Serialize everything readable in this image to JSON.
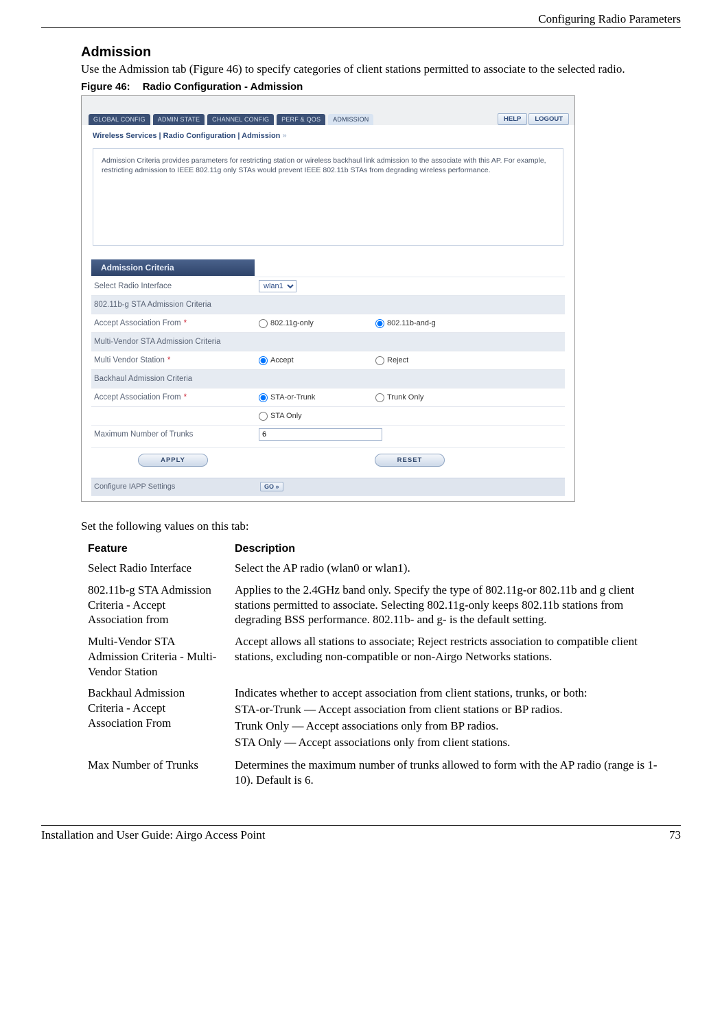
{
  "header": {
    "chapter": "Configuring Radio Parameters"
  },
  "section": {
    "title": "Admission",
    "intro": "Use the Admission tab (Figure 46) to specify categories of client stations permitted to associate to the selected radio.",
    "fig_num": "Figure 46:",
    "fig_title": "Radio Configuration - Admission",
    "after_fig": "Set the following values on this tab:"
  },
  "screenshot": {
    "tabs": [
      "GLOBAL CONFIG",
      "ADMIN STATE",
      "CHANNEL CONFIG",
      "PERF & QOS",
      "ADMISSION"
    ],
    "active_tab_index": 4,
    "top_buttons": {
      "help": "HELP",
      "logout": "LOGOUT"
    },
    "breadcrumb": "Wireless Services | Radio Configuration | Admission",
    "breadcrumb_arrows": "»",
    "desc_text": "Admission Criteria provides parameters for restricting station or wireless backhaul link admission to the associate with this AP. For example, restricting admission to IEEE 802.11g only STAs would prevent IEEE 802.11b STAs from degrading wireless performance.",
    "section_header": "Admission Criteria",
    "rows": {
      "select_radio_label": "Select Radio Interface",
      "select_radio_value": "wlan1",
      "sub1": "802.11b-g STA Admission Criteria",
      "accept_assoc_label": "Accept Association From",
      "accept_assoc_opt1": "802.11g-only",
      "accept_assoc_opt2": "802.11b-and-g",
      "sub2": "Multi-Vendor STA Admission Criteria",
      "multi_vendor_label": "Multi Vendor Station",
      "multi_vendor_opt1": "Accept",
      "multi_vendor_opt2": "Reject",
      "sub3": "Backhaul Admission Criteria",
      "backhaul_label": "Accept Association From",
      "backhaul_opt1": "STA-or-Trunk",
      "backhaul_opt2": "Trunk Only",
      "backhaul_opt3": "STA Only",
      "max_trunks_label": "Maximum Number of Trunks",
      "max_trunks_value": "6",
      "apply": "APPLY",
      "reset": "RESET",
      "iapp_label": "Configure IAPP Settings",
      "go": "GO »"
    }
  },
  "table": {
    "head_feature": "Feature",
    "head_desc": "Description",
    "rows": [
      {
        "feature": "Select Radio Interface",
        "desc": [
          "Select the AP radio (wlan0 or wlan1)."
        ]
      },
      {
        "feature": "802.11b-g STA Admission Criteria - Accept Association from",
        "desc": [
          "Applies to the 2.4GHz band only. Specify the type of 802.11g-or 802.11b and g client stations permitted to associate. Selecting 802.11g-only keeps 802.11b stations from degrading BSS performance. 802.11b- and g- is the default setting."
        ]
      },
      {
        "feature": "Multi-Vendor STA Admission Criteria - Multi-Vendor Station",
        "desc": [
          "Accept allows all stations to associate; Reject restricts association to compatible client stations, excluding non-compatible or non-Airgo Networks stations."
        ]
      },
      {
        "feature": "Backhaul Admission Criteria - Accept Association From",
        "desc": [
          "Indicates whether to accept association from client stations, trunks, or both:",
          "STA-or-Trunk — Accept association from client stations or BP radios.",
          "Trunk Only — Accept associations only from BP radios.",
          "STA Only — Accept associations only from client stations."
        ]
      },
      {
        "feature": "Max Number of Trunks",
        "desc": [
          "Determines the maximum number of trunks allowed to form with the AP radio (range is 1-10). Default is 6."
        ]
      }
    ]
  },
  "footer": {
    "left": "Installation and User Guide: Airgo Access Point",
    "right": "73"
  }
}
